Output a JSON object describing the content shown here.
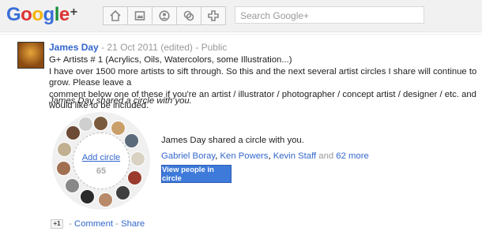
{
  "brand": {
    "letters": [
      "G",
      "o",
      "o",
      "g",
      "l",
      "e"
    ],
    "plus": "+"
  },
  "nav": {
    "icons": [
      "home-icon",
      "photos-icon",
      "profile-icon",
      "circles-icon",
      "games-icon"
    ]
  },
  "search": {
    "placeholder": "Search Google+"
  },
  "post": {
    "author": "James Day",
    "date": "21 Oct 2011 (edited)",
    "visibility": "Public",
    "sep": "-",
    "lines": [
      "G+ Artists # 1 (Acrylics, Oils, Watercolors, some Illustration...)",
      "I have over 1500 more artists to sift through. So this and the next several artist circles I share will continue to grow. Please leave a",
      "comment below one of these if you're an artist / illustrator / photographer / concept artist / designer / etc. and would like to be included."
    ],
    "shared_line": "James Day shared a circle with you.",
    "circle": {
      "add_label": "Add circle",
      "count": "65",
      "title": "James Day shared a circle with you.",
      "people": [
        "Gabriel Boray",
        "Ken Powers",
        "Kevin Staff"
      ],
      "and_text": "and",
      "more": "62 more",
      "button": "View people in circle"
    },
    "footer": {
      "plus_one": "+1",
      "comment": "Comment",
      "share": "Share",
      "sep": "-"
    }
  }
}
